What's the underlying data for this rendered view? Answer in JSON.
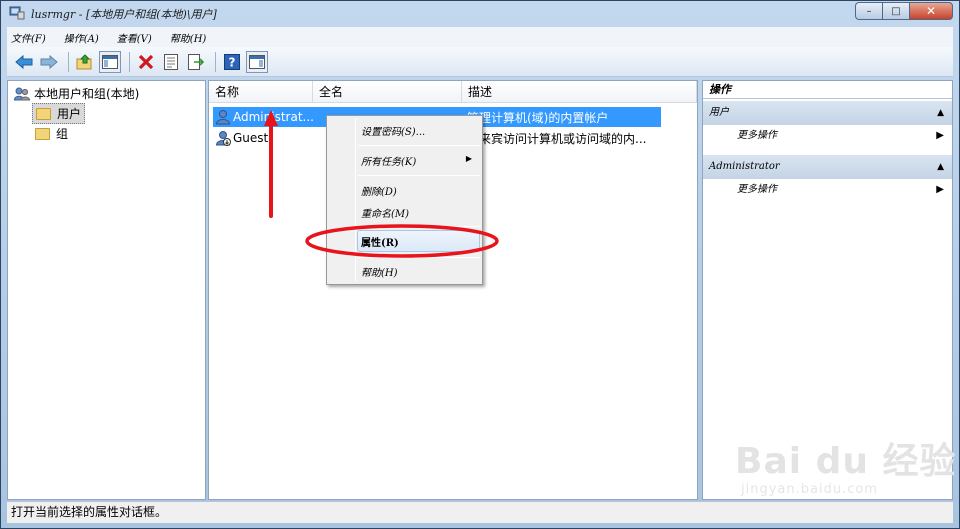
{
  "window": {
    "title": "lusrmgr - [本地用户和组(本地)\\用户]",
    "controls": {
      "minimize": "–",
      "maximize": "□",
      "close": "✕"
    }
  },
  "menu": [
    "文件(F)",
    "操作(A)",
    "查看(V)",
    "帮助(H)"
  ],
  "tree": {
    "root": "本地用户和组(本地)",
    "items": [
      {
        "label": "用户",
        "selected": true
      },
      {
        "label": "组",
        "selected": false
      }
    ]
  },
  "list": {
    "columns": [
      "名称",
      "全名",
      "描述"
    ],
    "rows": [
      {
        "name": "Administrat...",
        "fullname": "",
        "description": "管理计算机(域)的内置帐户",
        "selected": true
      },
      {
        "name": "Guest",
        "fullname": "",
        "description": "供来宾访问计算机或访问域的内...",
        "selected": false
      }
    ]
  },
  "actions": {
    "title": "操作",
    "groups": [
      {
        "label": "用户",
        "items": [
          "更多操作"
        ]
      },
      {
        "label": "Administrator",
        "items": [
          "更多操作"
        ]
      }
    ]
  },
  "context_menu": {
    "items": [
      "设置密码(S)...",
      "所有任务(K)",
      "删除(D)",
      "重命名(M)",
      "属性(R)",
      "帮助(H)"
    ],
    "highlighted": "属性(R)"
  },
  "status": "打开当前选择的属性对话框。",
  "watermark": {
    "logo": "Bai du 经验",
    "url": "jingyan.baidu.com"
  },
  "colors": {
    "selection": "#3399ff",
    "annotation": "#e8141c"
  }
}
